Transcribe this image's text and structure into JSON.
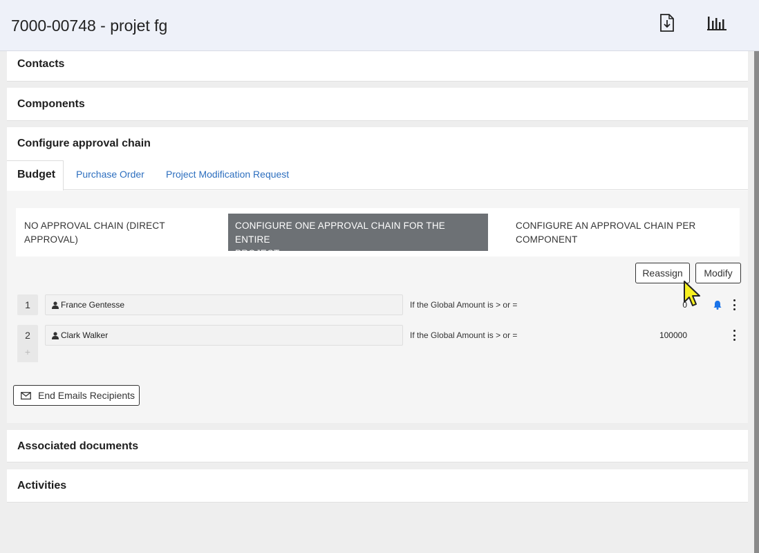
{
  "header": {
    "title": "7000-00748 - projet fg",
    "icons": [
      "download-icon",
      "bar-chart-icon"
    ]
  },
  "sections": {
    "contacts": "Contacts",
    "components": "Components",
    "approval": "Configure approval chain",
    "documents": "Associated documents",
    "activities": "Activities"
  },
  "tabs": [
    {
      "label": "Budget",
      "active": true
    },
    {
      "label": "Purchase Order",
      "active": false
    },
    {
      "label": "Project Modification Request",
      "active": false
    }
  ],
  "modes": {
    "none_line1": "NO APPROVAL CHAIN (DIRECT",
    "none_line2": "APPROVAL)",
    "one_line1": "CONFIGURE ONE APPROVAL CHAIN FOR THE ENTIRE",
    "one_line2": "PROJECT",
    "per_line1": "CONFIGURE AN APPROVAL CHAIN PER",
    "per_line2": "COMPONENT",
    "selected": "one"
  },
  "actions": {
    "reassign": "Reassign",
    "modify": "Modify",
    "add": "+",
    "end_emails": "End Emails Recipients"
  },
  "approvers": [
    {
      "num": "1",
      "name": "France Gentesse",
      "condition": "If the Global Amount is > or =",
      "amount": "0",
      "notify": true
    },
    {
      "num": "2",
      "name": "Clark Walker",
      "condition": "If the Global Amount is > or =",
      "amount": "100000",
      "notify": false
    }
  ],
  "colors": {
    "accent": "#2d6fbf",
    "selected_mode": "#6d7175",
    "topbar": "#eef1f9",
    "bell": "#1a73e8"
  }
}
